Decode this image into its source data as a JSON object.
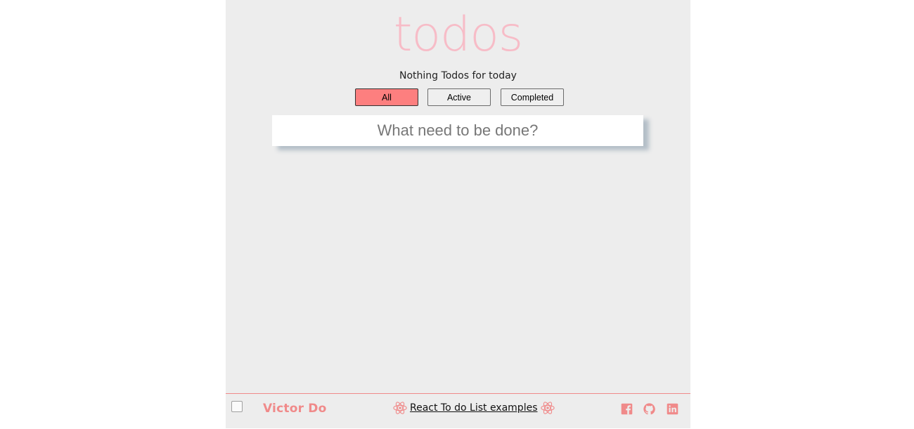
{
  "header": {
    "title": "todos",
    "subtitle": "Nothing Todos for today"
  },
  "filters": [
    {
      "label": "All",
      "selected": true
    },
    {
      "label": "Active",
      "selected": false
    },
    {
      "label": "Completed",
      "selected": false
    }
  ],
  "input": {
    "placeholder": "What need to be done?",
    "value": ""
  },
  "footer": {
    "author": "Victor Do",
    "link_text": "React To do List examples",
    "icons": [
      "react-icon",
      "facebook-icon",
      "github-icon",
      "linkedin-icon"
    ]
  },
  "colors": {
    "accent": "#fd7f7f",
    "title": "#f7bcc7",
    "footer_accent": "#f08a8a",
    "background": "#ededed"
  }
}
